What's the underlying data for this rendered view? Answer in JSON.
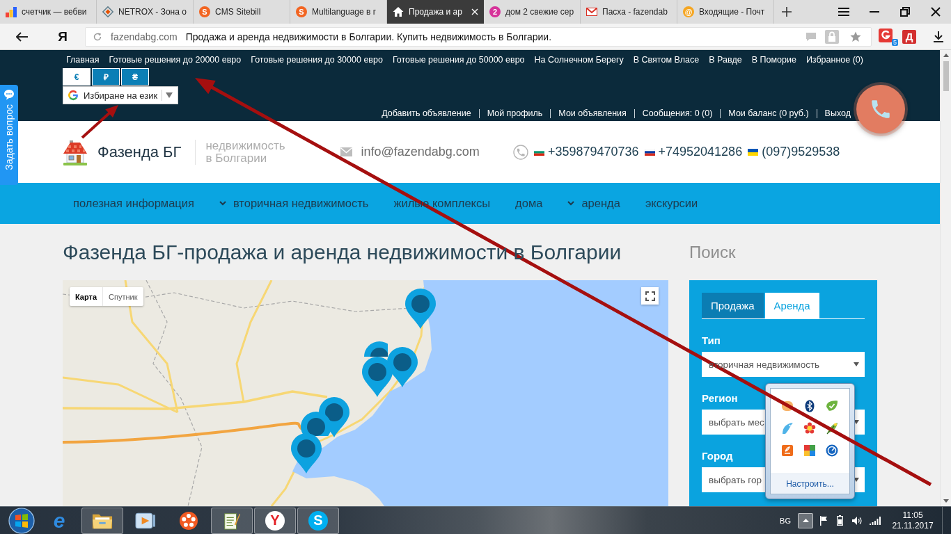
{
  "browser": {
    "tabs": [
      {
        "title": "счетчик — вебви",
        "kind": "chart",
        "selected": false
      },
      {
        "title": "NETROX - Зона о",
        "kind": "diamond",
        "selected": false
      },
      {
        "title": "CMS Sitebill",
        "kind": "letter",
        "icon_text": "S",
        "color": "#f26522",
        "selected": false
      },
      {
        "title": "Multilanguage в г",
        "kind": "letter",
        "icon_text": "S",
        "color": "#f26522",
        "selected": false
      },
      {
        "title": "Продажа и ар",
        "kind": "home",
        "selected": true
      },
      {
        "title": "дом 2 свежие сер",
        "kind": "letter",
        "icon_text": "2",
        "color": "#d6339a",
        "selected": false
      },
      {
        "title": "Пасха - fazendab",
        "kind": "mail",
        "selected": false
      },
      {
        "title": "Входящие - Почт",
        "kind": "letter",
        "icon_text": "@",
        "color": "#f5a623",
        "selected": false
      }
    ],
    "logo": "Я",
    "address": {
      "host": "fazendabg.com",
      "title": "Продажа и аренда недвижимости в Болгарии. Купить недвижимость в Болгарии."
    },
    "extensions": [
      {
        "kind": "badge",
        "badge": "5"
      },
      {
        "kind": "letter",
        "text": "Д"
      }
    ]
  },
  "page": {
    "top_nav": [
      "Главная",
      "Готовые решения до 20000 евро",
      "Готовые решения до 30000 евро",
      "Готовые решения до 50000 евро",
      "На Солнечном Берегу",
      "В Святом Власе",
      "В Равде",
      "В Поморие",
      "Избранное (0)"
    ],
    "currencies": [
      {
        "label": "€",
        "selected": true
      },
      {
        "label": "₽",
        "selected": false
      },
      {
        "label": "₴",
        "selected": false
      }
    ],
    "language_widget": {
      "label": "Избиране на език"
    },
    "user_links": [
      "Добавить объявление",
      "Мой профиль",
      "Мои объявления",
      "Сообщения: 0 (0)",
      "Мои баланс (0 руб.)",
      "Выход"
    ],
    "ask_tab": {
      "label": "Задать вопрос"
    },
    "header": {
      "brand": "Фазенда БГ",
      "tagline": "недвижимость в Болгарии",
      "email": "info@fazendabg.com",
      "phones": [
        {
          "kind": "bg",
          "number": "+359879470736"
        },
        {
          "kind": "ru",
          "number": "+74952041286"
        },
        {
          "kind": "ua",
          "number": "(097)9529538"
        }
      ]
    },
    "main_nav": [
      {
        "label": "полезная информация",
        "dropdown": false
      },
      {
        "label": "вторичная недвижимость",
        "dropdown": true
      },
      {
        "label": "жилые комплексы",
        "dropdown": false
      },
      {
        "label": "дома",
        "dropdown": false
      },
      {
        "label": "аренда",
        "dropdown": true
      },
      {
        "label": "экскурсии",
        "dropdown": false
      }
    ],
    "title": "Фазенда БГ-продажа и аренда недвижимости в Болгарии",
    "map": {
      "map_types": [
        {
          "label": "Карта",
          "selected": true
        },
        {
          "label": "Спутник",
          "selected": false
        }
      ]
    },
    "search": {
      "heading": "Поиск",
      "tabs": [
        {
          "label": "Продажа",
          "selected": true
        },
        {
          "label": "Аренда",
          "selected": false
        }
      ],
      "fields": [
        {
          "label": "Тип",
          "value": "вторичная недвижимость"
        },
        {
          "label": "Регион",
          "value": "выбрать мес"
        },
        {
          "label": "Город",
          "value": "выбрать гор"
        }
      ]
    }
  },
  "tray_popup": {
    "open": true,
    "link": "Настроить..."
  },
  "taskbar": {
    "apps": [
      {
        "kind": "ie",
        "glyph": "e",
        "running": false
      },
      {
        "kind": "explorer",
        "running": true
      },
      {
        "kind": "media",
        "running": false
      },
      {
        "kind": "reel",
        "running": false
      },
      {
        "kind": "notepad",
        "running": true
      },
      {
        "kind": "yandex",
        "glyph": "Y",
        "running": true
      },
      {
        "kind": "skype",
        "glyph": "S",
        "running": true
      }
    ],
    "language": "BG",
    "time": "11:05",
    "date": "21.11.2017"
  }
}
